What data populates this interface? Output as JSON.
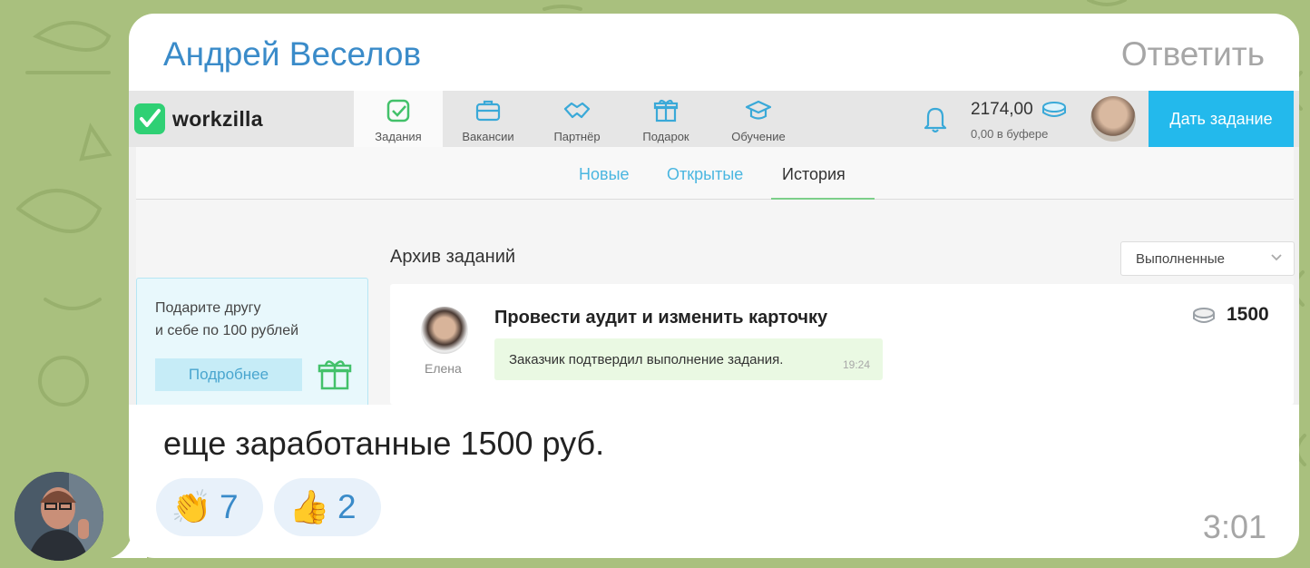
{
  "message": {
    "sender_name": "Андрей Веселов",
    "reply_label": "Ответить",
    "text": "еще заработанные 1500 руб.",
    "time": "3:01",
    "reactions": [
      {
        "emoji": "👏",
        "count": "7"
      },
      {
        "emoji": "👍",
        "count": "2"
      }
    ]
  },
  "screenshot": {
    "logo_text": "workzilla",
    "nav": [
      {
        "label": "Задания",
        "icon": "check-square-icon"
      },
      {
        "label": "Вакансии",
        "icon": "briefcase-icon"
      },
      {
        "label": "Партнёр",
        "icon": "handshake-icon"
      },
      {
        "label": "Подарок",
        "icon": "gift-icon"
      },
      {
        "label": "Обучение",
        "icon": "graduation-cap-icon"
      }
    ],
    "balance": "2174,00",
    "buffer": "0,00 в буфере",
    "cta_label": "Дать задание",
    "subtabs": [
      "Новые",
      "Открытые",
      "История"
    ],
    "promo": {
      "line1": "Подарите другу",
      "line2": "и себе по 100 рублей",
      "button": "Подробнее"
    },
    "archive_title": "Архив заданий",
    "filter_value": "Выполненные",
    "task": {
      "title": "Провести аудит и изменить карточку",
      "client_name": "Елена",
      "status_text": "Заказчик подтвердил выполнение задания.",
      "status_time": "19:24",
      "price": "1500"
    },
    "colors": {
      "accent_blue": "#23b9ec",
      "logo_green": "#2fd074",
      "status_bg": "#eaf9e3"
    }
  }
}
